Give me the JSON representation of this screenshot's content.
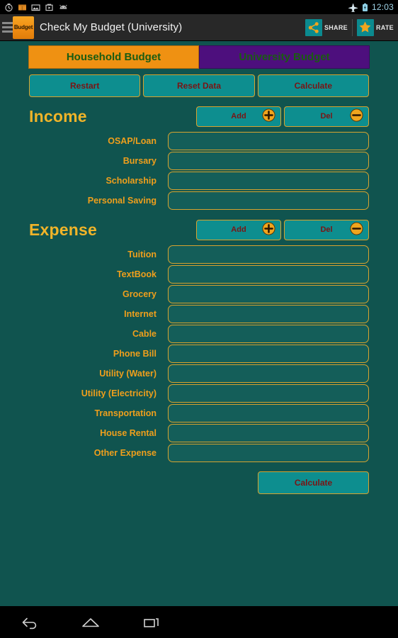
{
  "status_bar": {
    "icons": [
      "clock-icon",
      "app-update-icon",
      "image-icon",
      "play-store-icon",
      "android-icon"
    ],
    "airplane_icon": "airplane-mode-icon",
    "battery_icon": "battery-icon",
    "time": "12:03"
  },
  "action_bar": {
    "menu_icon": "hamburger-menu-icon",
    "logo_text": "Budget",
    "title": "Check My Budget (University)",
    "share": {
      "label": "SHARE",
      "icon": "share-icon"
    },
    "rate": {
      "label": "RATE",
      "icon": "star-icon"
    }
  },
  "tabs": [
    {
      "label": "Household Budget",
      "active": false,
      "color": "#ef9112"
    },
    {
      "label": "University Budget",
      "active": true,
      "color": "#4d0f7d"
    }
  ],
  "toolbar": {
    "restart_label": "Restart",
    "reset_label": "Reset Data",
    "calculate_label": "Calculate"
  },
  "income": {
    "title": "Income",
    "add_label": "Add",
    "del_label": "Del",
    "add_icon": "plus-circle-icon",
    "del_icon": "minus-circle-icon",
    "rows": [
      {
        "label": "OSAP/Loan",
        "value": "",
        "placeholder": ""
      },
      {
        "label": "Bursary",
        "value": "",
        "placeholder": ""
      },
      {
        "label": "Scholarship",
        "value": "",
        "placeholder": ""
      },
      {
        "label": "Personal Saving",
        "value": "",
        "placeholder": ""
      }
    ]
  },
  "expense": {
    "title": "Expense",
    "add_label": "Add",
    "del_label": "Del",
    "add_icon": "plus-circle-icon",
    "del_icon": "minus-circle-icon",
    "rows": [
      {
        "label": "Tuition",
        "value": "",
        "placeholder": ""
      },
      {
        "label": "TextBook",
        "value": "",
        "placeholder": ""
      },
      {
        "label": "Grocery",
        "value": "",
        "placeholder": ""
      },
      {
        "label": "Internet",
        "value": "",
        "placeholder": ""
      },
      {
        "label": "Cable",
        "value": "",
        "placeholder": ""
      },
      {
        "label": "Phone Bill",
        "value": "",
        "placeholder": ""
      },
      {
        "label": "Utility (Water)",
        "value": "",
        "placeholder": ""
      },
      {
        "label": "Utility (Electricity)",
        "value": "",
        "placeholder": ""
      },
      {
        "label": "Transportation",
        "value": "",
        "placeholder": ""
      },
      {
        "label": "House Rental",
        "value": "",
        "placeholder": ""
      },
      {
        "label": "Other Expense",
        "value": "",
        "placeholder": ""
      }
    ]
  },
  "footer": {
    "calculate_label": "Calculate"
  },
  "nav_bar": {
    "back_icon": "back-arrow-icon",
    "home_icon": "home-icon",
    "recents_icon": "recent-apps-icon"
  },
  "colors": {
    "background": "#10544f",
    "accent_orange": "#ef9f1c",
    "teal_button": "#0d8e8f",
    "gold_border": "#d6a330",
    "button_text": "#7a1414",
    "tab_text": "#1a5c12",
    "purple": "#4d0f7d"
  }
}
